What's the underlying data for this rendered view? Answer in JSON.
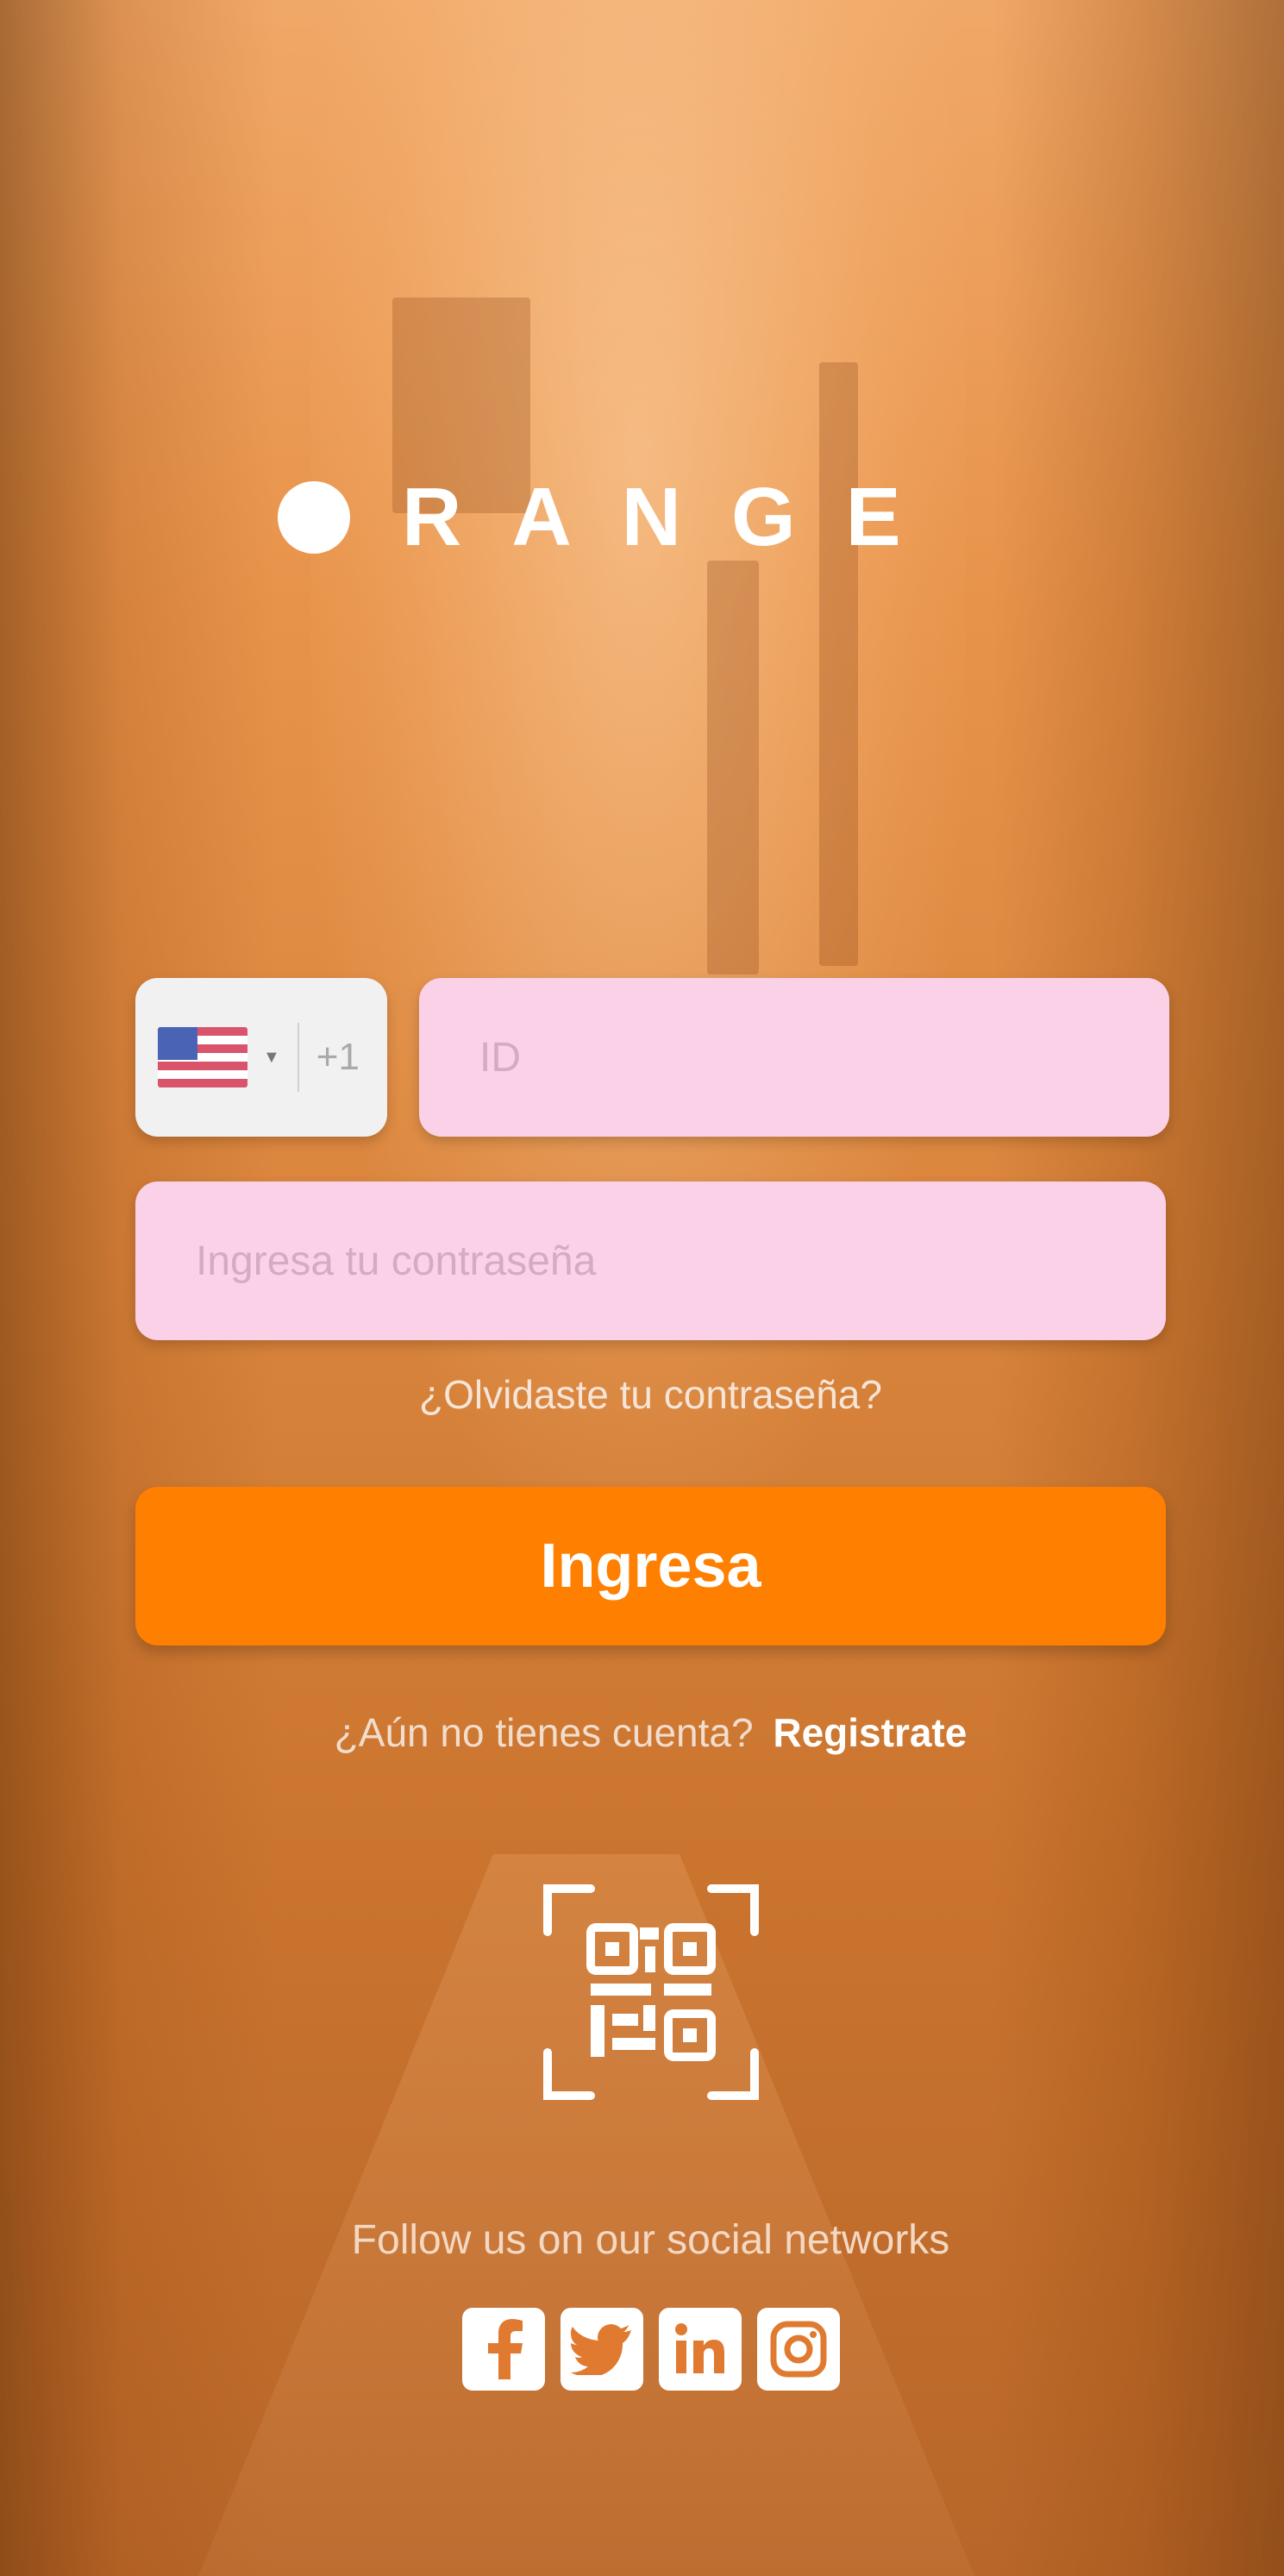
{
  "brand": {
    "logo_text": "RANGE",
    "accent_color": "#ff7f00",
    "field_color": "#fbd1e8"
  },
  "login_form": {
    "country": {
      "flag_icon": "us-flag-icon",
      "dial_code": "+1"
    },
    "id_placeholder": "ID",
    "password_placeholder": "Ingresa tu contraseña",
    "forgot_password": "¿Olvidaste tu contraseña?",
    "submit_label": "Ingresa"
  },
  "signup": {
    "prompt": "¿Aún no tienes cuenta?",
    "link": "Registrate"
  },
  "qr": {
    "icon": "qr-code-scan-icon"
  },
  "social": {
    "caption": "Follow us on our social networks",
    "icons": [
      "facebook-icon",
      "twitter-icon",
      "linkedin-icon",
      "instagram-icon"
    ]
  }
}
